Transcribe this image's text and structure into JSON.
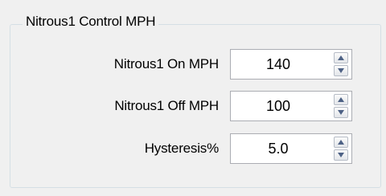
{
  "group": {
    "title": "Nitrous1 Control MPH"
  },
  "fields": [
    {
      "label": "Nitrous1 On MPH",
      "value": "140"
    },
    {
      "label": "Nitrous1 Off MPH",
      "value": "100"
    },
    {
      "label": "Hysteresis%",
      "value": "5.0"
    }
  ],
  "icons": {
    "increment": "spin-up-icon",
    "decrement": "spin-down-icon"
  },
  "colors": {
    "background": "#f0f0f0",
    "group_border": "#d5dfe5",
    "input_border": "#abadb3",
    "input_background": "#ffffff",
    "arrow": "#4d6185"
  }
}
